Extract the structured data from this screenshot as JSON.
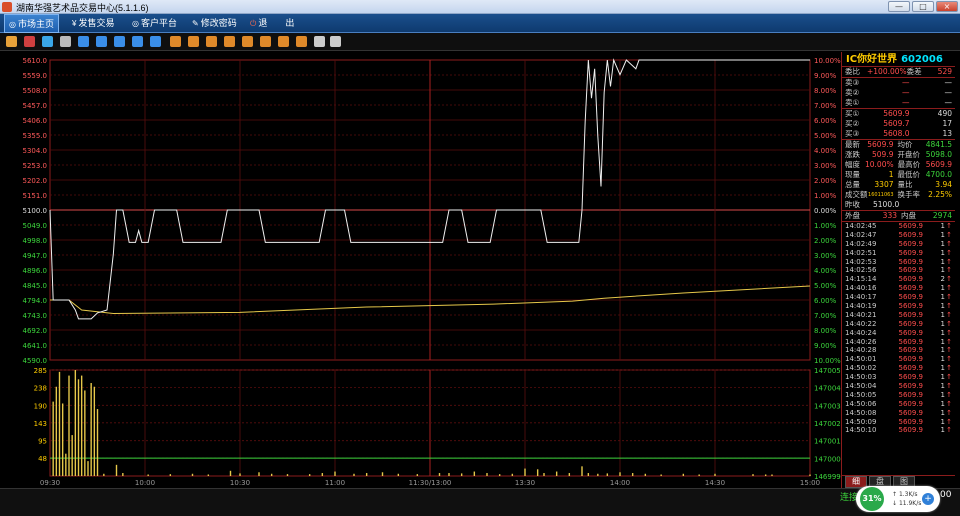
{
  "window": {
    "title": "湖南华强艺术品交易中心(5.1.1.6)",
    "minimize": "—",
    "maximize": "□",
    "close": "×"
  },
  "menu": [
    {
      "icon": "◎",
      "label": "市场主页",
      "active": true
    },
    {
      "icon": "¥",
      "label": "发售交易",
      "active": false
    },
    {
      "icon": "◎",
      "label": "客户平台",
      "active": false
    },
    {
      "icon": "✎",
      "label": "修改密码",
      "active": false
    },
    {
      "icon": "⏻",
      "label": "退",
      "active": false
    },
    {
      "icon": "",
      "label": "出",
      "active": false
    }
  ],
  "toolbar_icons": [
    "bar-chart-icon",
    "line-chart-icon",
    "candle-icon",
    "window-icon",
    "f1-icon",
    "f2-icon",
    "f3-icon",
    "f4-icon",
    "x-icon",
    "a1-icon",
    "a2-icon",
    "a3-icon",
    "a4-icon",
    "a5-icon",
    "a6-icon",
    "a7-icon",
    "a8-icon",
    "pen-icon",
    "gear-icon"
  ],
  "quote": {
    "name": "IC你好世界",
    "code": "602006",
    "weibi_label": "委比",
    "weibi": "+100.00%",
    "weicha_label": "委差",
    "weicha": "529",
    "sells": [
      {
        "label": "卖③",
        "price": "—",
        "qty": "—"
      },
      {
        "label": "卖②",
        "price": "—",
        "qty": "—"
      },
      {
        "label": "卖①",
        "price": "—",
        "qty": "—"
      }
    ],
    "buys": [
      {
        "label": "买①",
        "price": "5609.9",
        "qty": "490"
      },
      {
        "label": "买②",
        "price": "5609.7",
        "qty": "17"
      },
      {
        "label": "买③",
        "price": "5608.0",
        "qty": "13"
      }
    ],
    "stats": [
      {
        "l1": "最新",
        "v1": "5609.9",
        "l2": "均价",
        "v2": "4841.5",
        "c1": "red",
        "c2": "green"
      },
      {
        "l1": "涨跌",
        "v1": "509.9",
        "l2": "开盘价",
        "v2": "5098.0",
        "c1": "red",
        "c2": "green"
      },
      {
        "l1": "幅度",
        "v1": "10.00%",
        "l2": "最高价",
        "v2": "5609.9",
        "c1": "red",
        "c2": "red"
      },
      {
        "l1": "现量",
        "v1": "1",
        "l2": "最低价",
        "v2": "4700.0",
        "c1": "yellow",
        "c2": "green"
      },
      {
        "l1": "总量",
        "v1": "3307",
        "l2": "量比",
        "v2": "3.94",
        "c1": "yellow",
        "c2": "yellow"
      },
      {
        "l1": "成交额",
        "v1": "16011063",
        "l2": "换手率",
        "v2": "2.25%",
        "c1": "yellow",
        "c2": "yellow"
      }
    ],
    "prev_close_label": "昨收",
    "prev_close": "5100.0",
    "outer_label": "外盘",
    "outer": "333",
    "inner_label": "内盘",
    "inner": "2974"
  },
  "ticks": [
    {
      "t": "14:02:45",
      "p": "5609.9",
      "q": "1",
      "a": "↑"
    },
    {
      "t": "14:02:47",
      "p": "5609.9",
      "q": "1",
      "a": "↑"
    },
    {
      "t": "14:02:49",
      "p": "5609.9",
      "q": "1",
      "a": "↑"
    },
    {
      "t": "14:02:51",
      "p": "5609.9",
      "q": "1",
      "a": "↑"
    },
    {
      "t": "14:02:53",
      "p": "5609.9",
      "q": "1",
      "a": "↑"
    },
    {
      "t": "14:02:56",
      "p": "5609.9",
      "q": "1",
      "a": "↑"
    },
    {
      "t": "14:15:14",
      "p": "5609.9",
      "q": "2",
      "a": "↑"
    },
    {
      "t": "14:40:16",
      "p": "5609.9",
      "q": "1",
      "a": "↑"
    },
    {
      "t": "14:40:17",
      "p": "5609.9",
      "q": "1",
      "a": "↑"
    },
    {
      "t": "14:40:19",
      "p": "5609.9",
      "q": "1",
      "a": "↑"
    },
    {
      "t": "14:40:21",
      "p": "5609.9",
      "q": "1",
      "a": "↑"
    },
    {
      "t": "14:40:22",
      "p": "5609.9",
      "q": "1",
      "a": "↑"
    },
    {
      "t": "14:40:24",
      "p": "5609.9",
      "q": "1",
      "a": "↑"
    },
    {
      "t": "14:40:26",
      "p": "5609.9",
      "q": "1",
      "a": "↑"
    },
    {
      "t": "14:40:28",
      "p": "5609.9",
      "q": "1",
      "a": "↑"
    },
    {
      "t": "14:50:01",
      "p": "5609.9",
      "q": "1",
      "a": "↑"
    },
    {
      "t": "14:50:02",
      "p": "5609.9",
      "q": "1",
      "a": "↑"
    },
    {
      "t": "14:50:03",
      "p": "5609.9",
      "q": "1",
      "a": "↑"
    },
    {
      "t": "14:50:04",
      "p": "5609.9",
      "q": "1",
      "a": "↑"
    },
    {
      "t": "14:50:05",
      "p": "5609.9",
      "q": "1",
      "a": "↑"
    },
    {
      "t": "14:50:06",
      "p": "5609.9",
      "q": "1",
      "a": "↑"
    },
    {
      "t": "14:50:08",
      "p": "5609.9",
      "q": "1",
      "a": "↑"
    },
    {
      "t": "14:50:09",
      "p": "5609.9",
      "q": "1",
      "a": "↑"
    },
    {
      "t": "14:50:10",
      "p": "5609.9",
      "q": "1",
      "a": "↑"
    }
  ],
  "tabs": [
    "细",
    "盘",
    "图"
  ],
  "status": {
    "connection": "连接",
    "clock": "00"
  },
  "net": {
    "percent": "31%",
    "up": "1.3K/s",
    "down": "11.9K/s",
    "button": "+"
  },
  "chart_data": {
    "type": "line",
    "price_axis": {
      "ylim": [
        4590.0,
        5610.0
      ],
      "ticks": [
        "5610.0",
        "5559.0",
        "5508.0",
        "5457.0",
        "5406.0",
        "5355.0",
        "5304.0",
        "5253.0",
        "5202.0",
        "5151.0",
        "5100.0",
        "5049.0",
        "4998.0",
        "4947.0",
        "4896.0",
        "4845.0",
        "4794.0",
        "4743.0",
        "4692.0",
        "4641.0",
        "4590.0"
      ]
    },
    "pct_axis": {
      "ticks": [
        "10.00%",
        "9.00%",
        "8.00%",
        "7.00%",
        "6.00%",
        "5.00%",
        "4.00%",
        "3.00%",
        "2.00%",
        "1.00%",
        "0.00%",
        "1.00%",
        "2.00%",
        "3.00%",
        "4.00%",
        "5.00%",
        "6.00%",
        "7.00%",
        "8.00%",
        "9.00%",
        "10.00%"
      ]
    },
    "prev_close": 5100.0,
    "volume_axis": {
      "ylim": [
        0,
        285
      ],
      "ticks": [
        "285",
        "238",
        "190",
        "143",
        "95",
        "48"
      ]
    },
    "volume_right_ticks": [
      "147005",
      "147004",
      "147003",
      "147002",
      "147001",
      "147000",
      "146999"
    ],
    "x_labels": [
      "09:30",
      "10:00",
      "10:30",
      "11:00",
      "11:30/13:00",
      "13:30",
      "14:00",
      "14:30",
      "15:00"
    ],
    "x_range": [
      0,
      240
    ],
    "price_series": [
      [
        0,
        5100
      ],
      [
        1,
        4794
      ],
      [
        6,
        4794
      ],
      [
        8,
        4760
      ],
      [
        9,
        4730
      ],
      [
        13,
        4730
      ],
      [
        15,
        4750
      ],
      [
        18,
        4760
      ],
      [
        20,
        4950
      ],
      [
        21,
        5100
      ],
      [
        23,
        5100
      ],
      [
        25,
        4990
      ],
      [
        27,
        4990
      ],
      [
        28,
        5030
      ],
      [
        29,
        4990
      ],
      [
        31,
        4990
      ],
      [
        33,
        5100
      ],
      [
        40,
        5100
      ],
      [
        42,
        4990
      ],
      [
        54,
        4990
      ],
      [
        56,
        5100
      ],
      [
        66,
        5100
      ],
      [
        68,
        4990
      ],
      [
        85,
        4990
      ],
      [
        87,
        5100
      ],
      [
        93,
        5100
      ],
      [
        95,
        4990
      ],
      [
        124,
        4990
      ],
      [
        126,
        5100
      ],
      [
        130,
        5100
      ],
      [
        132,
        4990
      ],
      [
        139,
        4990
      ],
      [
        141,
        5100
      ],
      [
        155,
        5100
      ],
      [
        157,
        4990
      ],
      [
        167,
        4990
      ],
      [
        168,
        5100
      ],
      [
        169,
        5400
      ],
      [
        170,
        5609.9
      ],
      [
        171,
        5480
      ],
      [
        172,
        5580
      ],
      [
        173,
        5350
      ],
      [
        174,
        5180
      ],
      [
        175,
        5500
      ],
      [
        176,
        5609.9
      ],
      [
        177,
        5520
      ],
      [
        178,
        5609.9
      ],
      [
        180,
        5560
      ],
      [
        182,
        5609.9
      ],
      [
        185,
        5580
      ],
      [
        186,
        5609.9
      ],
      [
        240,
        5609.9
      ]
    ],
    "avg_series": [
      [
        0,
        4794
      ],
      [
        6,
        4794
      ],
      [
        10,
        4760
      ],
      [
        20,
        4748
      ],
      [
        60,
        4752
      ],
      [
        100,
        4770
      ],
      [
        140,
        4780
      ],
      [
        165,
        4790
      ],
      [
        175,
        4800
      ],
      [
        200,
        4818
      ],
      [
        240,
        4841.5
      ]
    ],
    "volume_series": [
      [
        1,
        200
      ],
      [
        2,
        240
      ],
      [
        3,
        280
      ],
      [
        4,
        195
      ],
      [
        5,
        60
      ],
      [
        6,
        270
      ],
      [
        7,
        110
      ],
      [
        8,
        285
      ],
      [
        9,
        260
      ],
      [
        10,
        270
      ],
      [
        11,
        230
      ],
      [
        12,
        40
      ],
      [
        13,
        250
      ],
      [
        14,
        240
      ],
      [
        15,
        180
      ],
      [
        17,
        6
      ],
      [
        21,
        30
      ],
      [
        23,
        8
      ],
      [
        31,
        4
      ],
      [
        38,
        5
      ],
      [
        45,
        6
      ],
      [
        50,
        4
      ],
      [
        57,
        14
      ],
      [
        60,
        7
      ],
      [
        66,
        10
      ],
      [
        70,
        6
      ],
      [
        75,
        5
      ],
      [
        82,
        5
      ],
      [
        86,
        8
      ],
      [
        90,
        12
      ],
      [
        96,
        6
      ],
      [
        100,
        8
      ],
      [
        105,
        10
      ],
      [
        110,
        6
      ],
      [
        116,
        5
      ],
      [
        123,
        8
      ],
      [
        126,
        8
      ],
      [
        130,
        7
      ],
      [
        134,
        12
      ],
      [
        138,
        8
      ],
      [
        142,
        5
      ],
      [
        146,
        6
      ],
      [
        150,
        20
      ],
      [
        154,
        18
      ],
      [
        156,
        8
      ],
      [
        160,
        12
      ],
      [
        164,
        8
      ],
      [
        168,
        26
      ],
      [
        170,
        8
      ],
      [
        173,
        6
      ],
      [
        176,
        7
      ],
      [
        180,
        10
      ],
      [
        184,
        8
      ],
      [
        188,
        6
      ],
      [
        193,
        4
      ],
      [
        200,
        6
      ],
      [
        205,
        4
      ],
      [
        210,
        6
      ],
      [
        222,
        5
      ],
      [
        226,
        4
      ],
      [
        228,
        4
      ],
      [
        240,
        4
      ]
    ],
    "volume_ma": 48
  }
}
